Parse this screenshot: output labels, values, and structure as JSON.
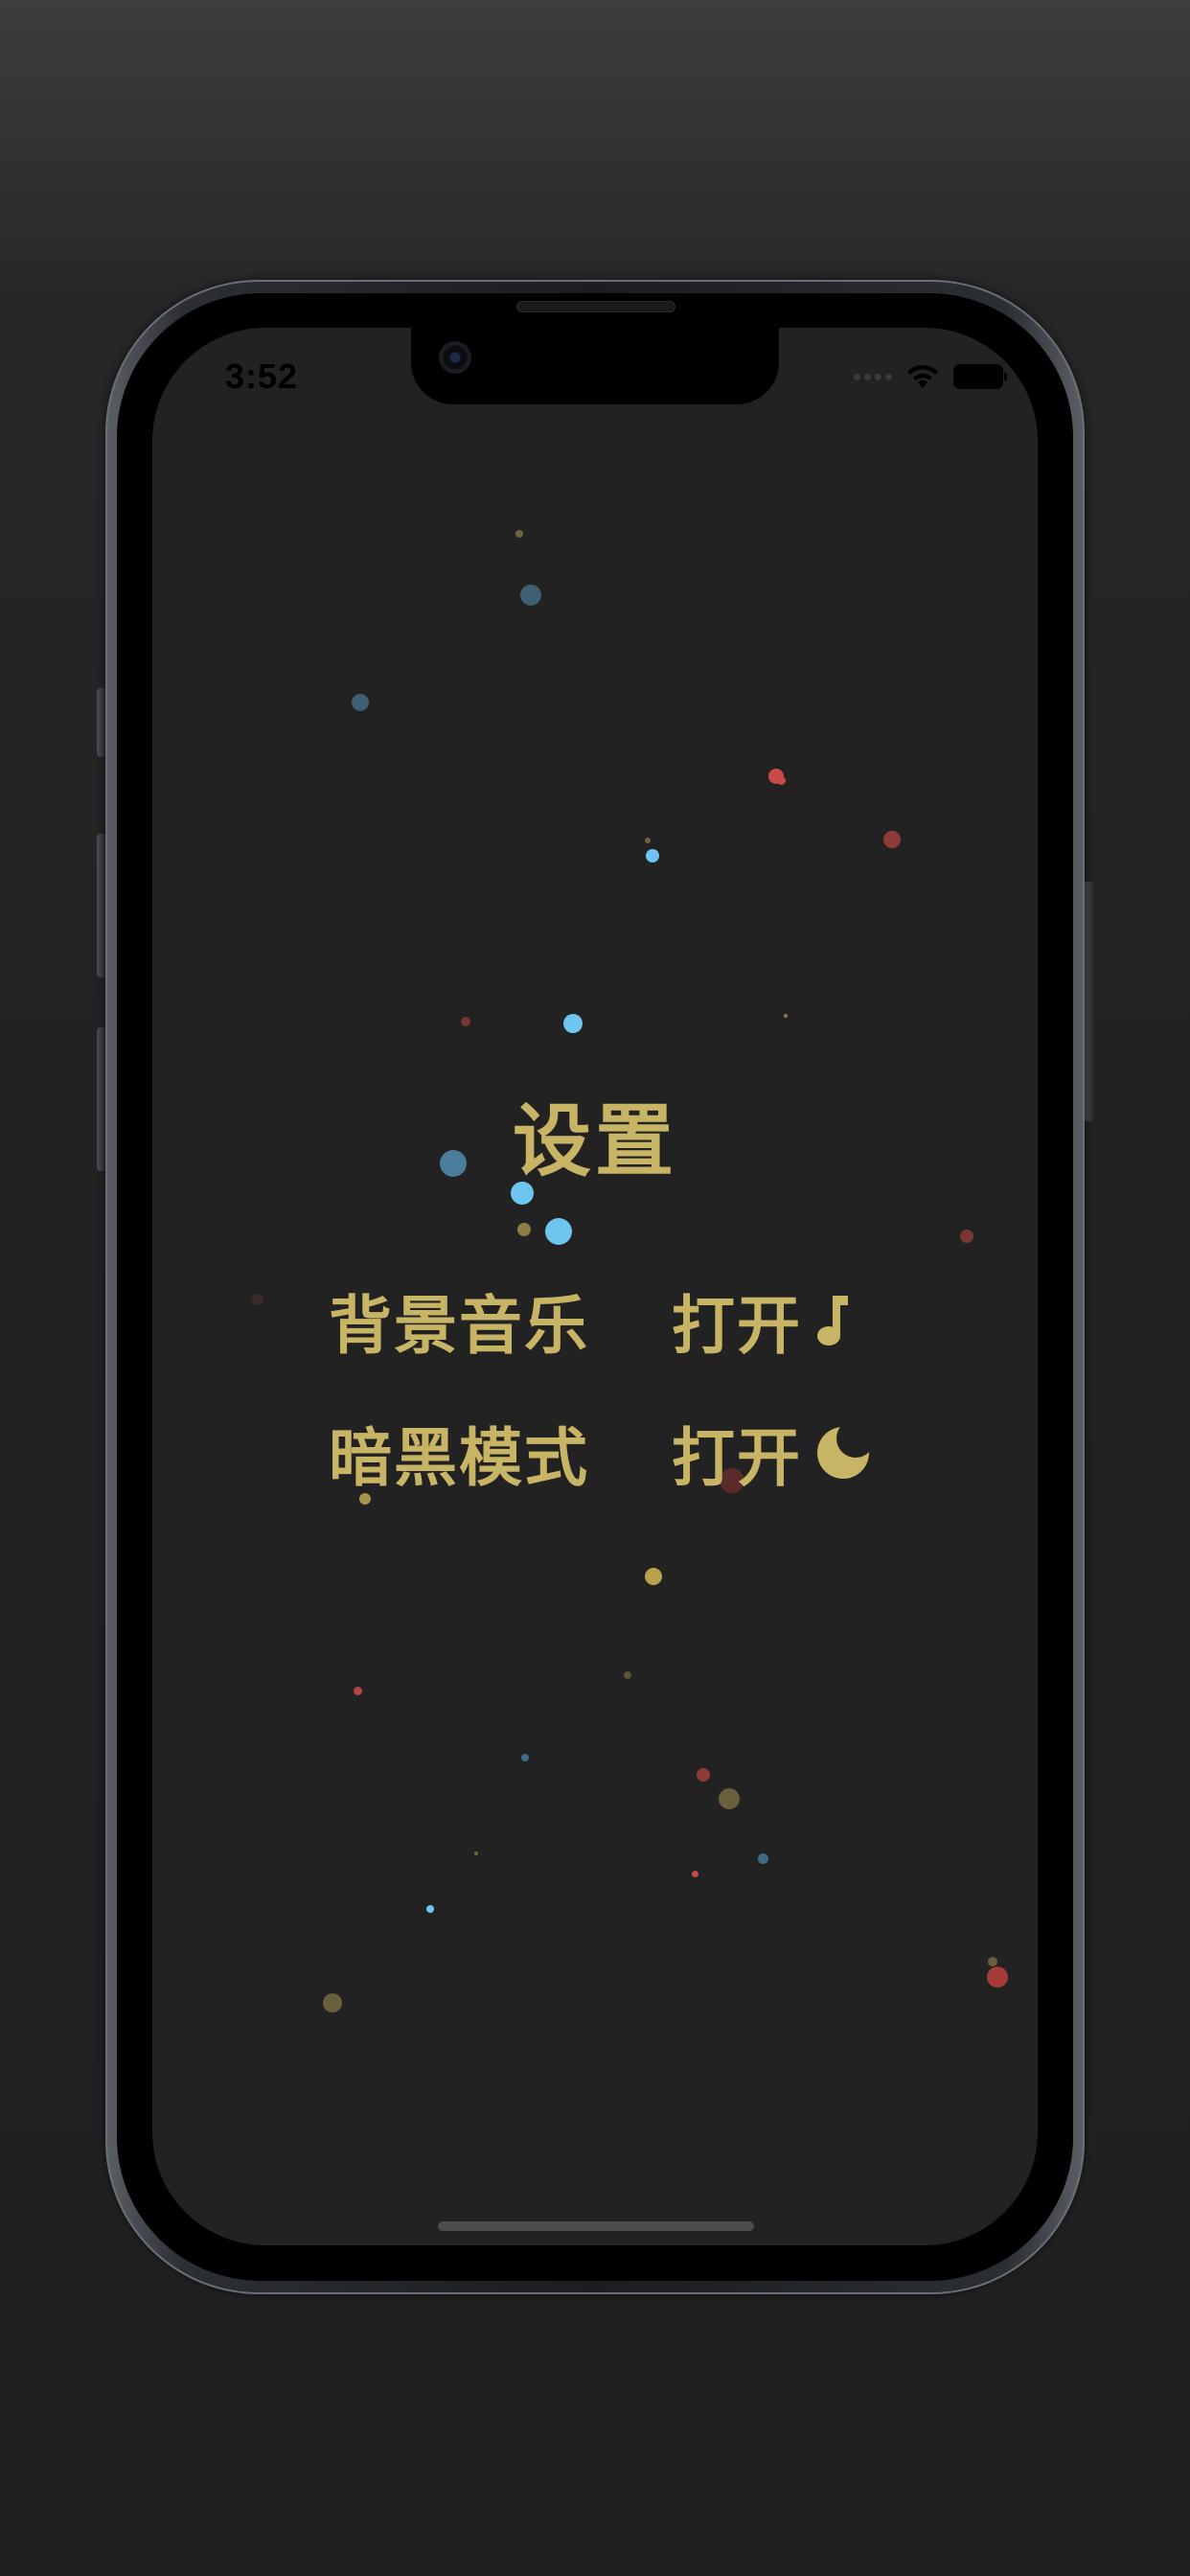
{
  "status_bar": {
    "time": "3:52"
  },
  "settings": {
    "title": "设置",
    "rows": [
      {
        "label": "背景音乐",
        "value": "打开",
        "icon": "music-note-icon"
      },
      {
        "label": "暗黑模式",
        "value": "打开",
        "icon": "moon-icon"
      }
    ]
  },
  "colors": {
    "accent": "#c8b465",
    "background": "#222222",
    "particle_blue": "#6ec6f0",
    "particle_red": "#c94a47",
    "particle_gold": "#a8934a"
  }
}
